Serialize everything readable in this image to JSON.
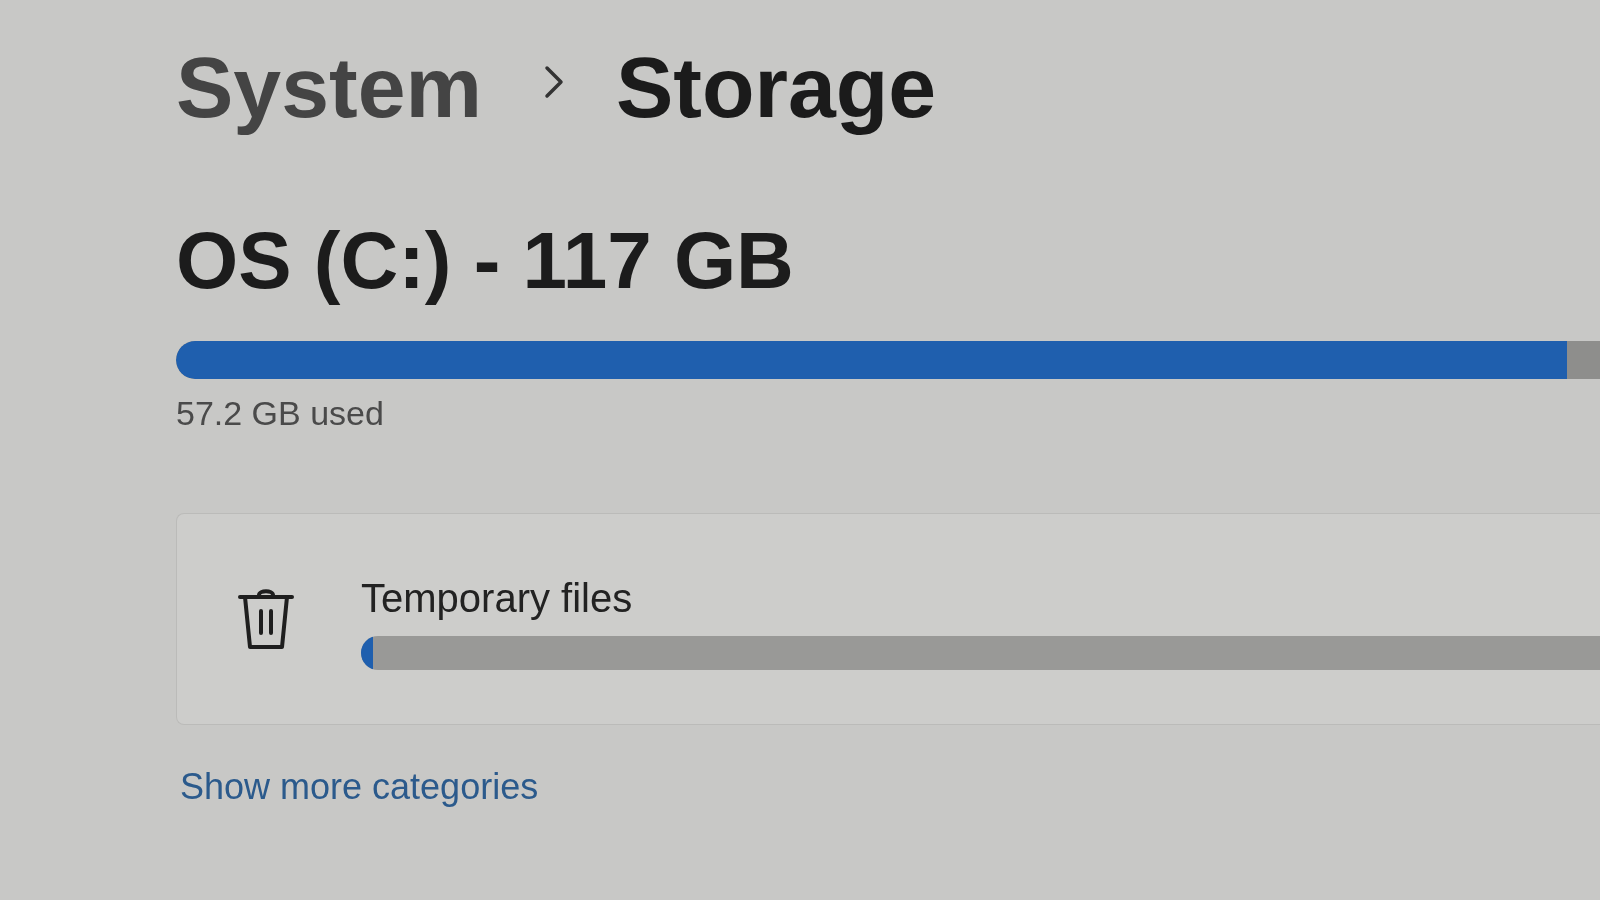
{
  "breadcrumb": [
    {
      "label": "System",
      "selected": false
    },
    {
      "label": "Storage",
      "selected": true
    }
  ],
  "drive": {
    "title": "OS (C:) - 117 GB",
    "level": 0.977,
    "usage": "57.2 GB used"
  },
  "categories": [
    {
      "name": "Temporary files",
      "level": 0.01
    }
  ],
  "more_link": "Show more categories"
}
